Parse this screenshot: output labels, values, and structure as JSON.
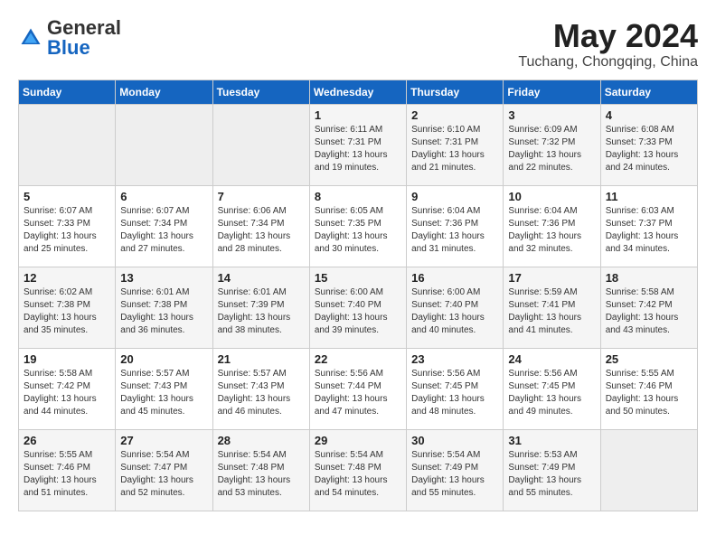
{
  "header": {
    "logo_general": "General",
    "logo_blue": "Blue",
    "month_year": "May 2024",
    "location": "Tuchang, Chongqing, China"
  },
  "weekdays": [
    "Sunday",
    "Monday",
    "Tuesday",
    "Wednesday",
    "Thursday",
    "Friday",
    "Saturday"
  ],
  "weeks": [
    [
      {
        "day": "",
        "sunrise": "",
        "sunset": "",
        "daylight": ""
      },
      {
        "day": "",
        "sunrise": "",
        "sunset": "",
        "daylight": ""
      },
      {
        "day": "",
        "sunrise": "",
        "sunset": "",
        "daylight": ""
      },
      {
        "day": "1",
        "sunrise": "Sunrise: 6:11 AM",
        "sunset": "Sunset: 7:31 PM",
        "daylight": "Daylight: 13 hours and 19 minutes."
      },
      {
        "day": "2",
        "sunrise": "Sunrise: 6:10 AM",
        "sunset": "Sunset: 7:31 PM",
        "daylight": "Daylight: 13 hours and 21 minutes."
      },
      {
        "day": "3",
        "sunrise": "Sunrise: 6:09 AM",
        "sunset": "Sunset: 7:32 PM",
        "daylight": "Daylight: 13 hours and 22 minutes."
      },
      {
        "day": "4",
        "sunrise": "Sunrise: 6:08 AM",
        "sunset": "Sunset: 7:33 PM",
        "daylight": "Daylight: 13 hours and 24 minutes."
      }
    ],
    [
      {
        "day": "5",
        "sunrise": "Sunrise: 6:07 AM",
        "sunset": "Sunset: 7:33 PM",
        "daylight": "Daylight: 13 hours and 25 minutes."
      },
      {
        "day": "6",
        "sunrise": "Sunrise: 6:07 AM",
        "sunset": "Sunset: 7:34 PM",
        "daylight": "Daylight: 13 hours and 27 minutes."
      },
      {
        "day": "7",
        "sunrise": "Sunrise: 6:06 AM",
        "sunset": "Sunset: 7:34 PM",
        "daylight": "Daylight: 13 hours and 28 minutes."
      },
      {
        "day": "8",
        "sunrise": "Sunrise: 6:05 AM",
        "sunset": "Sunset: 7:35 PM",
        "daylight": "Daylight: 13 hours and 30 minutes."
      },
      {
        "day": "9",
        "sunrise": "Sunrise: 6:04 AM",
        "sunset": "Sunset: 7:36 PM",
        "daylight": "Daylight: 13 hours and 31 minutes."
      },
      {
        "day": "10",
        "sunrise": "Sunrise: 6:04 AM",
        "sunset": "Sunset: 7:36 PM",
        "daylight": "Daylight: 13 hours and 32 minutes."
      },
      {
        "day": "11",
        "sunrise": "Sunrise: 6:03 AM",
        "sunset": "Sunset: 7:37 PM",
        "daylight": "Daylight: 13 hours and 34 minutes."
      }
    ],
    [
      {
        "day": "12",
        "sunrise": "Sunrise: 6:02 AM",
        "sunset": "Sunset: 7:38 PM",
        "daylight": "Daylight: 13 hours and 35 minutes."
      },
      {
        "day": "13",
        "sunrise": "Sunrise: 6:01 AM",
        "sunset": "Sunset: 7:38 PM",
        "daylight": "Daylight: 13 hours and 36 minutes."
      },
      {
        "day": "14",
        "sunrise": "Sunrise: 6:01 AM",
        "sunset": "Sunset: 7:39 PM",
        "daylight": "Daylight: 13 hours and 38 minutes."
      },
      {
        "day": "15",
        "sunrise": "Sunrise: 6:00 AM",
        "sunset": "Sunset: 7:40 PM",
        "daylight": "Daylight: 13 hours and 39 minutes."
      },
      {
        "day": "16",
        "sunrise": "Sunrise: 6:00 AM",
        "sunset": "Sunset: 7:40 PM",
        "daylight": "Daylight: 13 hours and 40 minutes."
      },
      {
        "day": "17",
        "sunrise": "Sunrise: 5:59 AM",
        "sunset": "Sunset: 7:41 PM",
        "daylight": "Daylight: 13 hours and 41 minutes."
      },
      {
        "day": "18",
        "sunrise": "Sunrise: 5:58 AM",
        "sunset": "Sunset: 7:42 PM",
        "daylight": "Daylight: 13 hours and 43 minutes."
      }
    ],
    [
      {
        "day": "19",
        "sunrise": "Sunrise: 5:58 AM",
        "sunset": "Sunset: 7:42 PM",
        "daylight": "Daylight: 13 hours and 44 minutes."
      },
      {
        "day": "20",
        "sunrise": "Sunrise: 5:57 AM",
        "sunset": "Sunset: 7:43 PM",
        "daylight": "Daylight: 13 hours and 45 minutes."
      },
      {
        "day": "21",
        "sunrise": "Sunrise: 5:57 AM",
        "sunset": "Sunset: 7:43 PM",
        "daylight": "Daylight: 13 hours and 46 minutes."
      },
      {
        "day": "22",
        "sunrise": "Sunrise: 5:56 AM",
        "sunset": "Sunset: 7:44 PM",
        "daylight": "Daylight: 13 hours and 47 minutes."
      },
      {
        "day": "23",
        "sunrise": "Sunrise: 5:56 AM",
        "sunset": "Sunset: 7:45 PM",
        "daylight": "Daylight: 13 hours and 48 minutes."
      },
      {
        "day": "24",
        "sunrise": "Sunrise: 5:56 AM",
        "sunset": "Sunset: 7:45 PM",
        "daylight": "Daylight: 13 hours and 49 minutes."
      },
      {
        "day": "25",
        "sunrise": "Sunrise: 5:55 AM",
        "sunset": "Sunset: 7:46 PM",
        "daylight": "Daylight: 13 hours and 50 minutes."
      }
    ],
    [
      {
        "day": "26",
        "sunrise": "Sunrise: 5:55 AM",
        "sunset": "Sunset: 7:46 PM",
        "daylight": "Daylight: 13 hours and 51 minutes."
      },
      {
        "day": "27",
        "sunrise": "Sunrise: 5:54 AM",
        "sunset": "Sunset: 7:47 PM",
        "daylight": "Daylight: 13 hours and 52 minutes."
      },
      {
        "day": "28",
        "sunrise": "Sunrise: 5:54 AM",
        "sunset": "Sunset: 7:48 PM",
        "daylight": "Daylight: 13 hours and 53 minutes."
      },
      {
        "day": "29",
        "sunrise": "Sunrise: 5:54 AM",
        "sunset": "Sunset: 7:48 PM",
        "daylight": "Daylight: 13 hours and 54 minutes."
      },
      {
        "day": "30",
        "sunrise": "Sunrise: 5:54 AM",
        "sunset": "Sunset: 7:49 PM",
        "daylight": "Daylight: 13 hours and 55 minutes."
      },
      {
        "day": "31",
        "sunrise": "Sunrise: 5:53 AM",
        "sunset": "Sunset: 7:49 PM",
        "daylight": "Daylight: 13 hours and 55 minutes."
      },
      {
        "day": "",
        "sunrise": "",
        "sunset": "",
        "daylight": ""
      }
    ]
  ]
}
